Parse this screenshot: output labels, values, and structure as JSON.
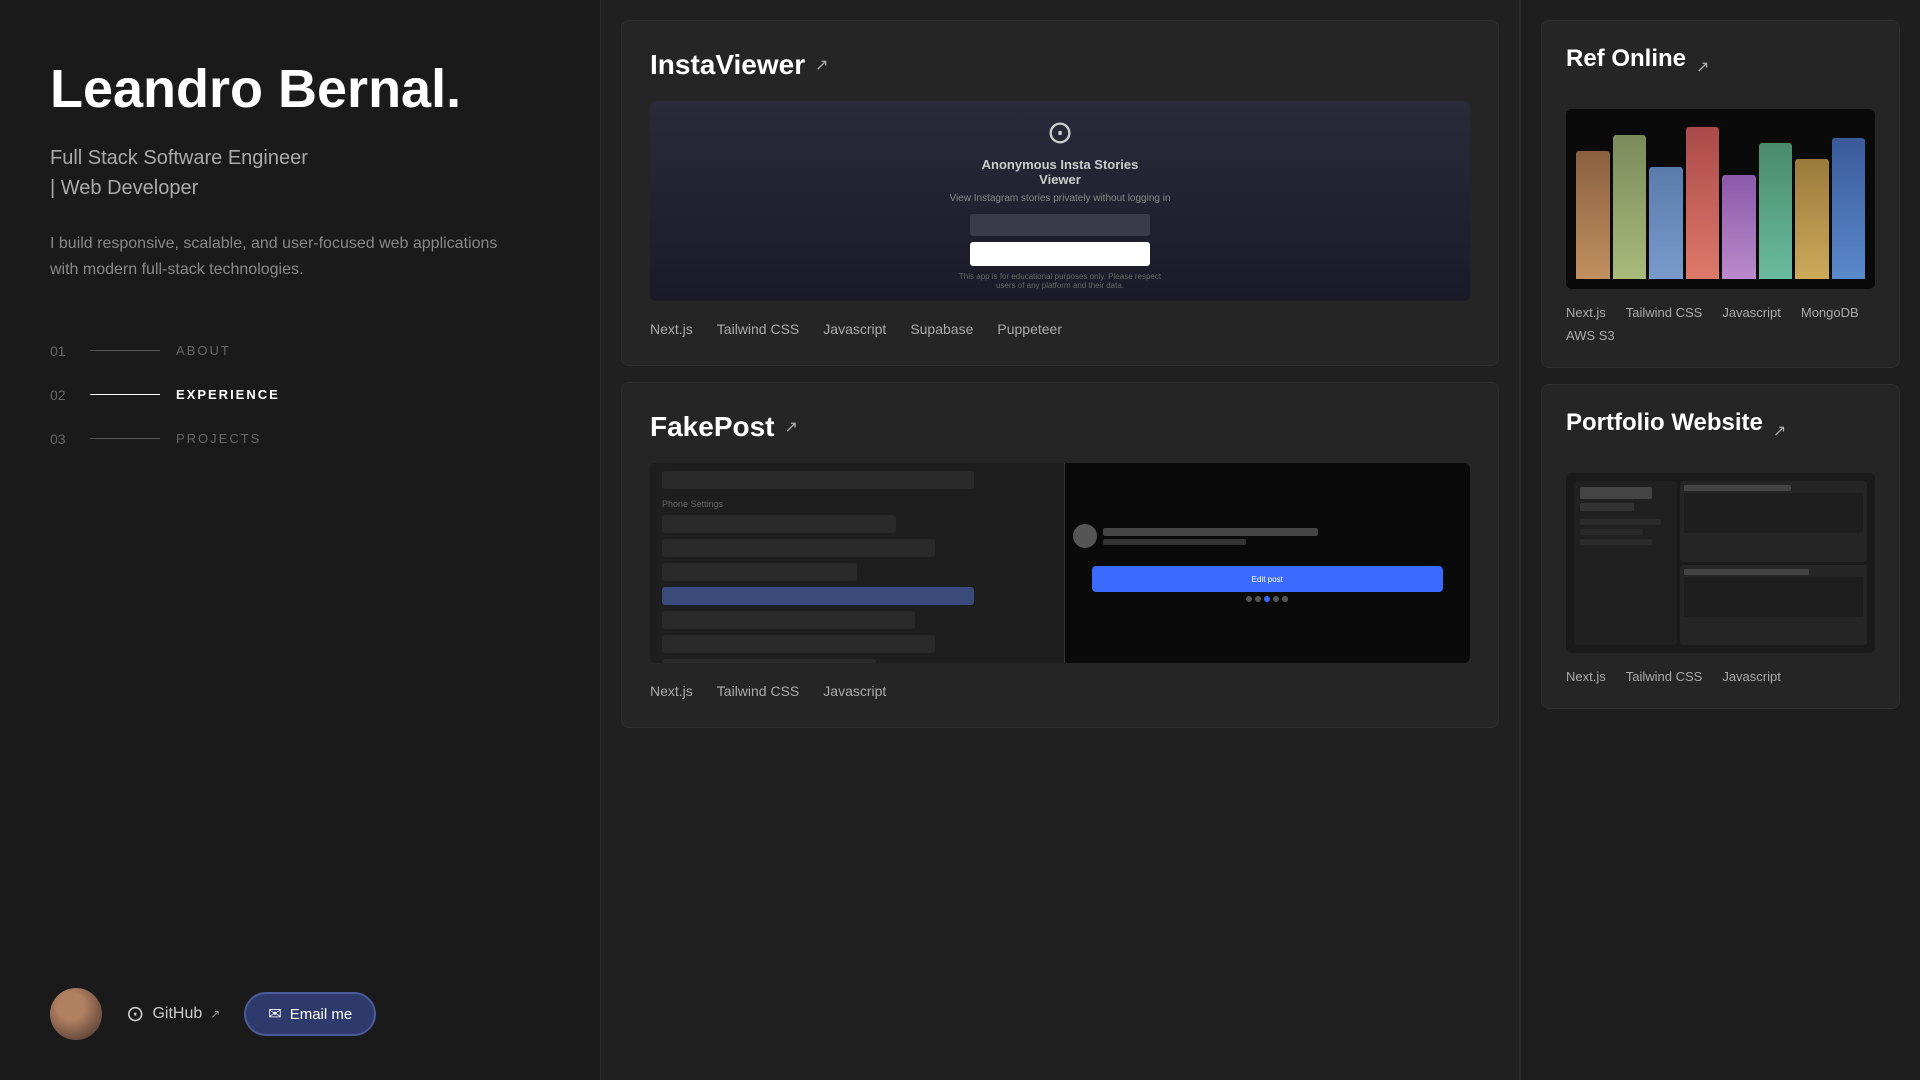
{
  "sidebar": {
    "name": "Leandro Bernal.",
    "title_line1": "Full Stack Software Engineer",
    "title_line2": "| Web Developer",
    "bio": "I build responsive, scalable, and user-focused web applications with modern full-stack technologies.",
    "nav": [
      {
        "num": "01",
        "label": "ABOUT",
        "active": false
      },
      {
        "num": "02",
        "label": "EXPERIENCE",
        "active": true
      },
      {
        "num": "03",
        "label": "PROJECTS",
        "active": false
      }
    ],
    "github_label": "GitHub",
    "email_label": "Email me"
  },
  "projects": {
    "center": [
      {
        "id": "instaviewer",
        "title": "InstaViewer",
        "tags": [
          "Next.js",
          "Tailwind CSS",
          "Javascript",
          "Supabase",
          "Puppeteer"
        ],
        "tags_row1": [
          "Next.js",
          "Tailwind CSS",
          "Javascript"
        ],
        "tags_row2": [
          "Supabase",
          "Puppeteer"
        ],
        "screenshot_type": "instaviewer",
        "insta_heading": "Anonymous Insta Stories",
        "insta_subheading": "Viewer",
        "insta_desc": "View Instagram stories privately without logging in"
      },
      {
        "id": "fakepost",
        "title": "FakePost",
        "tags": [
          "Next.js",
          "Tailwind CSS",
          "Javascript"
        ],
        "tags_row1": [
          "Next.js",
          "Tailwind CSS",
          "Javascript"
        ],
        "screenshot_type": "fakepost"
      }
    ],
    "right": [
      {
        "id": "ref-online",
        "title": "Ref Online",
        "tags_row1": [
          "Next.js",
          "Tailwind CSS",
          "Javascript"
        ],
        "tags_row2": [
          "MongoDB",
          "AWS S3"
        ],
        "screenshot_type": "ref"
      },
      {
        "id": "portfolio-website",
        "title": "Portfolio Website",
        "tags_row1": [
          "Next.js",
          "Tailwind CSS",
          "Javascript"
        ],
        "screenshot_type": "portfolio"
      }
    ]
  },
  "colors": {
    "accent": "#2d3a6b",
    "border_accent": "#4a5a9a"
  }
}
